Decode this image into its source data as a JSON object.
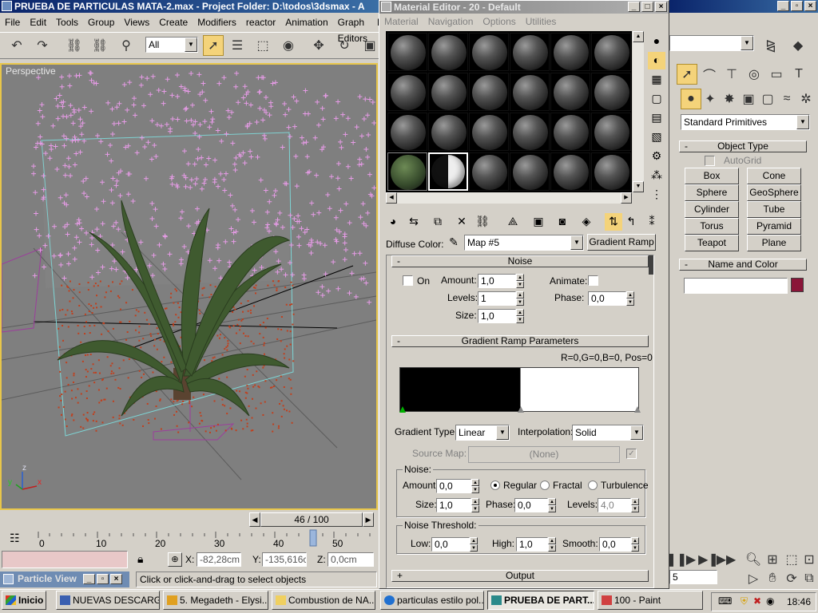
{
  "max_window": {
    "title": "PRUEBA DE PARTICULAS MATA-2.max    - Project Folder: D:\\todos\\3dsmax    - A",
    "menu": [
      "File",
      "Edit",
      "Tools",
      "Group",
      "Views",
      "Create",
      "Modifiers",
      "reactor",
      "Animation",
      "Graph Editors",
      "Re"
    ],
    "selection_filter": "All",
    "viewport_label": "Perspective",
    "time_slider": "46 / 100",
    "ruler_ticks": [
      "0",
      "10",
      "20",
      "30",
      "40",
      "50"
    ],
    "coords": {
      "x_label": "X:",
      "x": "-82,28cm",
      "y_label": "Y:",
      "y": "-135,616cm",
      "z_label": "Z:",
      "z": "0,0cm"
    },
    "status": "Click or click-and-drag to select objects",
    "particle_view": "Particle View",
    "axis_labels": {
      "x": "x",
      "y": "y",
      "z": "z"
    }
  },
  "command_panel": {
    "category": "Standard Primitives",
    "object_type_title": "Object Type",
    "autogrid": "AutoGrid",
    "buttons": [
      "Box",
      "Cone",
      "Sphere",
      "GeoSphere",
      "Cylinder",
      "Tube",
      "Torus",
      "Pyramid",
      "Teapot",
      "Plane"
    ],
    "name_color_title": "Name and Color",
    "object_color": "#8a1538",
    "spinner_value": "5"
  },
  "material_editor": {
    "title": "Material Editor - 20 - Default",
    "menu": [
      "Material",
      "Navigation",
      "Options",
      "Utilities"
    ],
    "diffuse_label": "Diffuse Color:",
    "map_name": "Map #5",
    "map_type": "Gradient Ramp",
    "noise_rollout": {
      "title": "Noise",
      "on_label": "On",
      "amount_label": "Amount:",
      "amount": "1,0",
      "levels_label": "Levels:",
      "levels": "1",
      "size_label": "Size:",
      "size": "1,0",
      "animate_label": "Animate:",
      "phase_label": "Phase:",
      "phase": "0,0"
    },
    "gradient_rollout": {
      "title": "Gradient Ramp Parameters",
      "flag_info": "R=0,G=0,B=0, Pos=0",
      "gradient_type_label": "Gradient Type:",
      "gradient_type": "Linear",
      "interpolation_label": "Interpolation:",
      "interpolation": "Solid",
      "source_map_label": "Source Map:",
      "source_map": "(None)",
      "noise_group": "Noise:",
      "amount_label": "Amount:",
      "amount": "0,0",
      "regular": "Regular",
      "fractal": "Fractal",
      "turbulence": "Turbulence",
      "size_label": "Size:",
      "size": "1,0",
      "phase_label": "Phase:",
      "phase": "0,0",
      "levels_label": "Levels:",
      "levels": "4,0",
      "threshold_group": "Noise Threshold:",
      "low_label": "Low:",
      "low": "0,0",
      "high_label": "High:",
      "high": "1,0",
      "smooth_label": "Smooth:",
      "smooth": "0,0"
    },
    "output_rollout": "Output"
  },
  "taskbar": {
    "start": "Inicio",
    "items": [
      "NUEVAS DESCARG...",
      "5. Megadeth - Elysi...",
      "Combustion de NA...",
      "particulas estilo pol...",
      "PRUEBA DE PART...",
      "100 - Paint"
    ],
    "clock": "18:46"
  }
}
